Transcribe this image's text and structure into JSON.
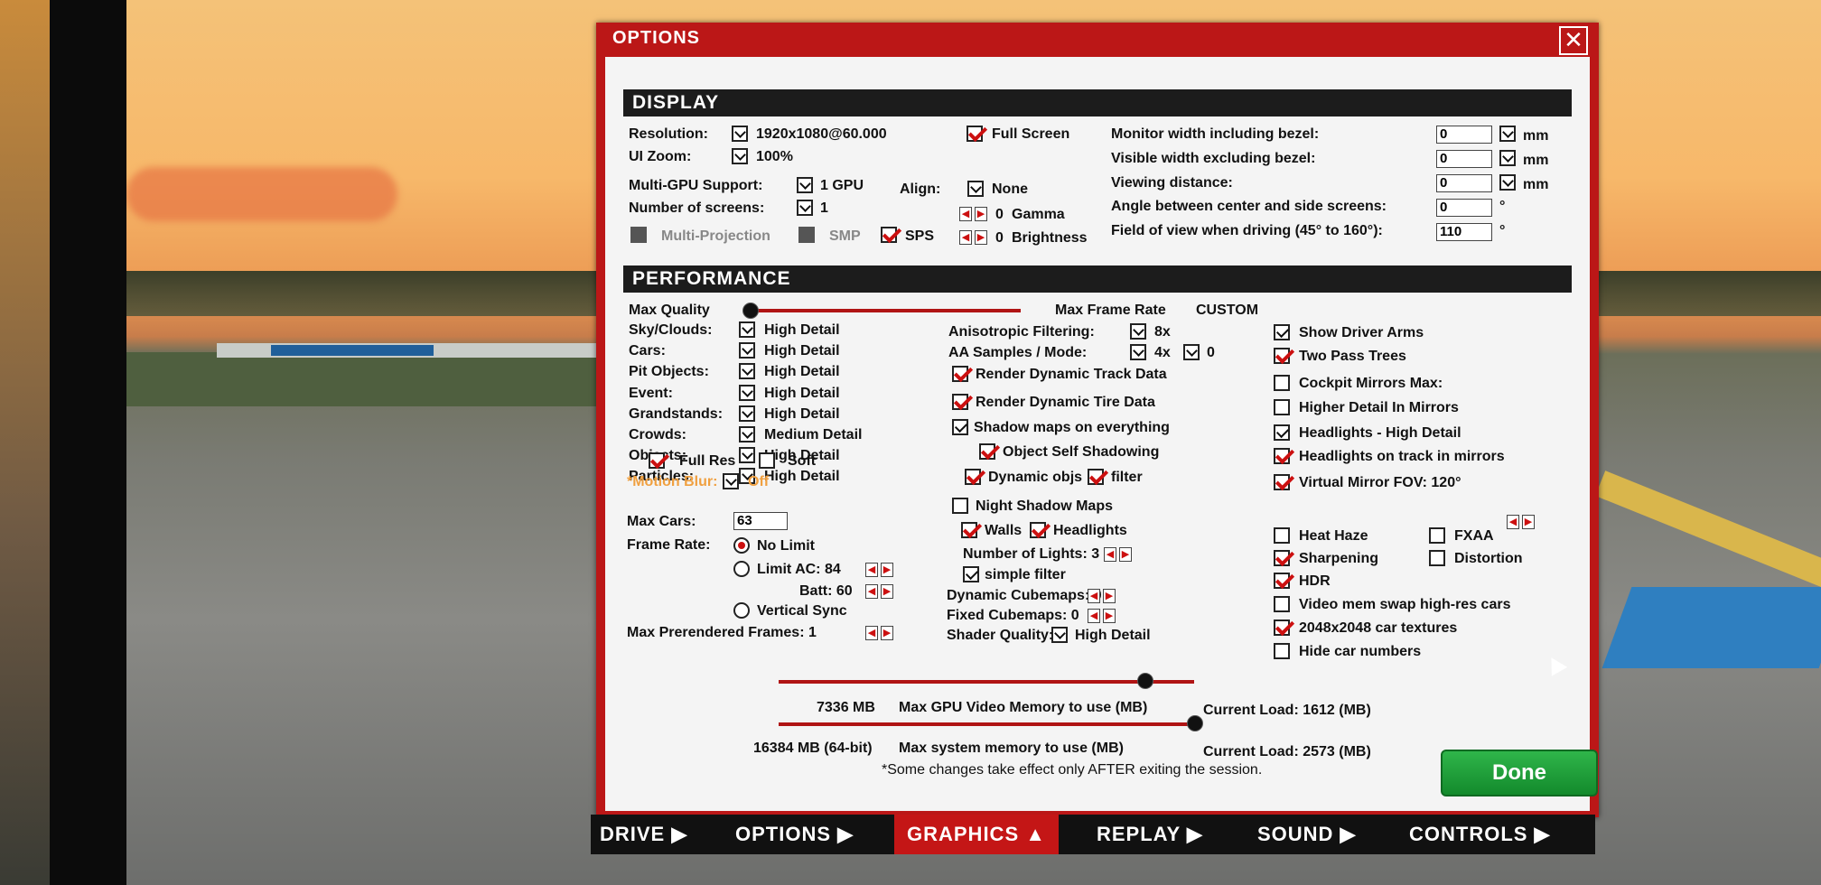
{
  "window": {
    "title": "OPTIONS"
  },
  "display": {
    "header": "DISPLAY",
    "resolution_label": "Resolution:",
    "resolution_value": "1920x1080@60.000",
    "fullscreen_label": "Full Screen",
    "ui_zoom_label": "UI Zoom:",
    "ui_zoom_value": "100%",
    "multi_gpu_label": "Multi-GPU Support:",
    "multi_gpu_value": "1 GPU",
    "screens_label": "Number of screens:",
    "screens_value": "1",
    "align_label": "Align:",
    "align_value": "None",
    "gamma_value": "0",
    "gamma_label": "Gamma",
    "brightness_value": "0",
    "brightness_label": "Brightness",
    "multi_projection_label": "Multi-Projection",
    "smp_label": "SMP",
    "sps_label": "SPS",
    "monitor_width_label": "Monitor width including bezel:",
    "monitor_width_value": "0",
    "visible_width_label": "Visible width excluding bezel:",
    "visible_width_value": "0",
    "viewing_distance_label": "Viewing distance:",
    "viewing_distance_value": "0",
    "angle_label": "Angle between center and side screens:",
    "angle_value": "0",
    "fov_label": "Field of view when driving (45° to 160°):",
    "fov_value": "110",
    "unit_mm": "mm",
    "unit_deg": "°"
  },
  "performance": {
    "header": "PERFORMANCE",
    "max_quality_label": "Max Quality",
    "max_frame_rate_label": "Max Frame Rate",
    "preset_value": "CUSTOM",
    "detail_rows": [
      {
        "label": "Sky/Clouds:",
        "value": "High Detail"
      },
      {
        "label": "Cars:",
        "value": "High Detail"
      },
      {
        "label": "Pit Objects:",
        "value": "High Detail"
      },
      {
        "label": "Event:",
        "value": "High Detail"
      },
      {
        "label": "Grandstands:",
        "value": "High Detail"
      },
      {
        "label": "Crowds:",
        "value": "Medium Detail"
      },
      {
        "label": "Objects:",
        "value": "High Detail"
      },
      {
        "label": "Particles:",
        "value": "High Detail"
      }
    ],
    "full_res_label": "Full Res",
    "soft_label": "Soft",
    "motion_blur_label": "*Motion Blur:",
    "motion_blur_value": "Off",
    "max_cars_label": "Max Cars:",
    "max_cars_value": "63",
    "frame_rate_label": "Frame Rate:",
    "no_limit_label": "No Limit",
    "limit_ac_label": "Limit AC: 84",
    "batt_label": "Batt: 60",
    "vsync_label": "Vertical Sync",
    "prerendered_label": "Max Prerendered Frames: 1",
    "aniso_label": "Anisotropic Filtering:",
    "aniso_value": "8x",
    "aa_label": "AA Samples / Mode:",
    "aa_value": "4x",
    "aa_mode_value": "0",
    "dyn_track_label": "Render Dynamic Track Data",
    "dyn_tire_label": "Render Dynamic Tire Data",
    "shadow_everything_label": "Shadow maps on everything",
    "self_shadow_label": "Object Self Shadowing",
    "dynamic_objs_label": "Dynamic objs",
    "filter_label": "filter",
    "night_shadow_label": "Night Shadow Maps",
    "walls_label": "Walls",
    "headlights_label": "Headlights",
    "num_lights_label": "Number of Lights: 3",
    "simple_filter_label": "simple filter",
    "dyn_cubemaps_label": "Dynamic Cubemaps: 0",
    "fixed_cubemaps_label": "Fixed Cubemaps: 0",
    "shader_quality_label": "Shader Quality:",
    "shader_quality_value": "High Detail",
    "right_options": [
      {
        "label": "Show Driver Arms",
        "state": "v"
      },
      {
        "label": "Two Pass Trees",
        "state": "r"
      },
      {
        "label": "Cockpit Mirrors  Max:",
        "state": ""
      },
      {
        "label": "Higher Detail In Mirrors",
        "state": ""
      },
      {
        "label": "Headlights - High Detail",
        "state": "v"
      },
      {
        "label": "Headlights on track in mirrors",
        "state": "r"
      },
      {
        "label": "Virtual Mirror   FOV:  120°",
        "state": "r"
      }
    ],
    "heat_haze_label": "Heat Haze",
    "fxaa_label": "FXAA",
    "sharpening_label": "Sharpening",
    "distortion_label": "Distortion",
    "hdr_label": "HDR",
    "video_swap_label": "Video mem swap high-res cars",
    "car_textures_label": "2048x2048 car textures",
    "hide_numbers_label": "Hide car numbers",
    "gpu_mem_value": "7336 MB",
    "gpu_mem_label": "Max GPU Video Memory to use (MB)",
    "gpu_load_label": "Current Load: 1612 (MB)",
    "sys_mem_value": "16384 MB (64-bit)",
    "sys_mem_label": "Max system memory to use (MB)",
    "sys_load_label": "Current Load: 2573 (MB)",
    "gpu_mem_fraction": 0.88,
    "sys_mem_fraction": 1.0,
    "max_quality_fraction": 0.0
  },
  "footer_note": "*Some changes take effect only AFTER exiting the session.",
  "done_label": "Done",
  "tabs": [
    {
      "label": "DRIVE ▶"
    },
    {
      "label": "OPTIONS ▶"
    },
    {
      "label": "GRAPHICS ▲"
    },
    {
      "label": "REPLAY ▶"
    },
    {
      "label": "SOUND ▶"
    },
    {
      "label": "CONTROLS ▶"
    }
  ]
}
